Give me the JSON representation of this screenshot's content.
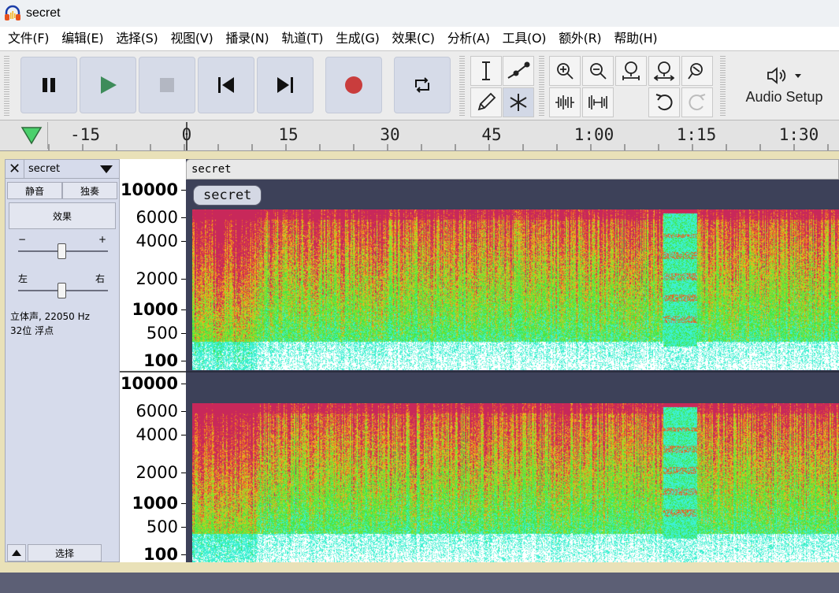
{
  "window": {
    "title": "secret"
  },
  "menu": [
    "文件(F)",
    "编辑(E)",
    "选择(S)",
    "视图(V)",
    "播录(N)",
    "轨道(T)",
    "生成(G)",
    "效果(C)",
    "分析(A)",
    "工具(O)",
    "额外(R)",
    "帮助(H)"
  ],
  "toolbar": {
    "audio_setup_label": "Audio Setup",
    "transport": [
      "pause-icon",
      "play-icon",
      "stop-icon",
      "skip-to-start-icon",
      "skip-to-end-icon",
      "record-icon",
      "loop-icon"
    ],
    "tools": [
      "selection-tool-icon",
      "envelope-tool-icon",
      "draw-tool-icon",
      "multi-tool-icon"
    ],
    "zoom": [
      "zoom-in-icon",
      "zoom-out-icon",
      "fit-selection-icon",
      "fit-project-icon",
      "zoom-toggle-icon",
      "trim-outside-icon",
      "silence-selection-icon",
      "undo-icon",
      "redo-icon"
    ]
  },
  "ruler": {
    "ticks": [
      "-15",
      "0",
      "15",
      "30",
      "45",
      "1:00",
      "1:15",
      "1:30"
    ]
  },
  "track": {
    "name": "secret",
    "mute_label": "静音",
    "solo_label": "独奏",
    "effects_label": "效果",
    "gain_minus": "−",
    "gain_plus": "+",
    "pan_left": "左",
    "pan_right": "右",
    "format_line1": "立体声, 22050 Hz",
    "format_line2": "32位 浮点",
    "select_label": "选择",
    "clip_header": "secret",
    "clip_name": "secret"
  },
  "freq_scale": [
    "10000",
    "6000",
    "4000",
    "2000",
    "1000",
    "500",
    "100"
  ],
  "colors": {
    "accent_play": "#3e8c5a",
    "record": "#c93d3d",
    "track_border": "#e9e1b8"
  }
}
